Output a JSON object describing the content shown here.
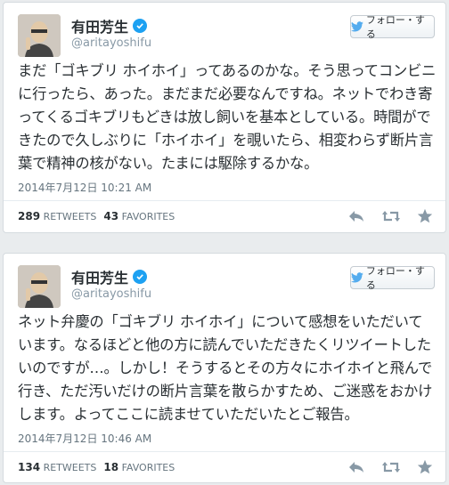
{
  "tweets": [
    {
      "name": "有田芳生",
      "handle": "@aritayoshifu",
      "follow_label": "フォロー・する",
      "text": "まだ「ゴキブリ ホイホイ」ってあるのかな。そう思ってコンビニに行ったら、あった。まだまだ必要なんですね。ネットでわき寄ってくるゴキブリもどきは放し飼いを基本としている。時間ができたので久しぶりに「ホイホイ」を覗いたら、相変わらず断片言葉で精神の核がない。たまには駆除するかな。",
      "timestamp": "2014年7月12日 10:21 AM",
      "retweets": "289",
      "retweets_label": "RETWEETS",
      "favorites": "43",
      "favorites_label": "FAVORITES"
    },
    {
      "name": "有田芳生",
      "handle": "@aritayoshifu",
      "follow_label": "フォロー・する",
      "text": "ネット弁慶の「ゴキブリ ホイホイ」について感想をいただいています。なるほどと他の方に読んでいただきたくリツイートしたいのですが…。しかし！そうするとその方々にホイホイと飛んで行き、ただ汚いだけの断片言葉を散らかすため、ご迷惑をおかけします。よってここに読ませていただいたとご報告。",
      "timestamp": "2014年7月12日 10:46 AM",
      "retweets": "134",
      "retweets_label": "RETWEETS",
      "favorites": "18",
      "favorites_label": "FAVORITES"
    }
  ],
  "icons": [
    "avatar",
    "verified-badge-icon",
    "twitter-bird-icon",
    "reply-icon",
    "retweet-icon",
    "favorite-star-icon"
  ],
  "colors": {
    "verified": "#1da1f2",
    "bird": "#55acee",
    "action_icons": "#8899a6"
  }
}
